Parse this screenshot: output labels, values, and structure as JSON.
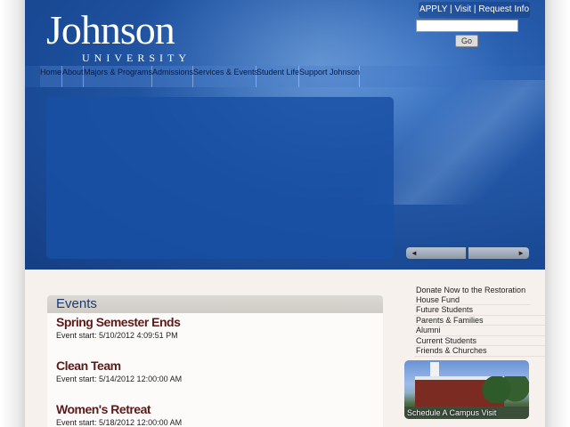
{
  "logo": {
    "main": "Johnson",
    "sub": "UNIVERSITY"
  },
  "utility": {
    "apply": "APPLY",
    "sep1": " | ",
    "visit": "Visit",
    "sep2": " | ",
    "request_info": "Request Info"
  },
  "search": {
    "placeholder": "",
    "go_label": "Go"
  },
  "nav": {
    "items": [
      {
        "label": "Home"
      },
      {
        "label": "About"
      },
      {
        "label": "Majors & Programs"
      },
      {
        "label": "Admissions"
      },
      {
        "label": "Services & Events"
      },
      {
        "label": "Student Life"
      },
      {
        "label": "Support Johnson"
      }
    ]
  },
  "slideshow": {
    "prev": "◄",
    "next": "►"
  },
  "events": {
    "heading": "Events",
    "items": [
      {
        "title": "Spring Semester Ends",
        "start": "Event start: 5/10/2012 4:09:51 PM"
      },
      {
        "title": "Clean Team",
        "start": "Event start: 5/14/2012 12:00:00 AM"
      },
      {
        "title": "Women's Retreat",
        "start": "Event start: 5/18/2012 12:00:00 AM"
      }
    ]
  },
  "links": {
    "items": [
      {
        "label": "Donate Now to the Restoration House Fund"
      },
      {
        "label": "Future Students"
      },
      {
        "label": "Parents & Families"
      },
      {
        "label": "Alumni"
      },
      {
        "label": "Current Students"
      },
      {
        "label": "Friends & Churches"
      }
    ]
  },
  "campus_visit": {
    "label": "Schedule A Campus Visit"
  }
}
